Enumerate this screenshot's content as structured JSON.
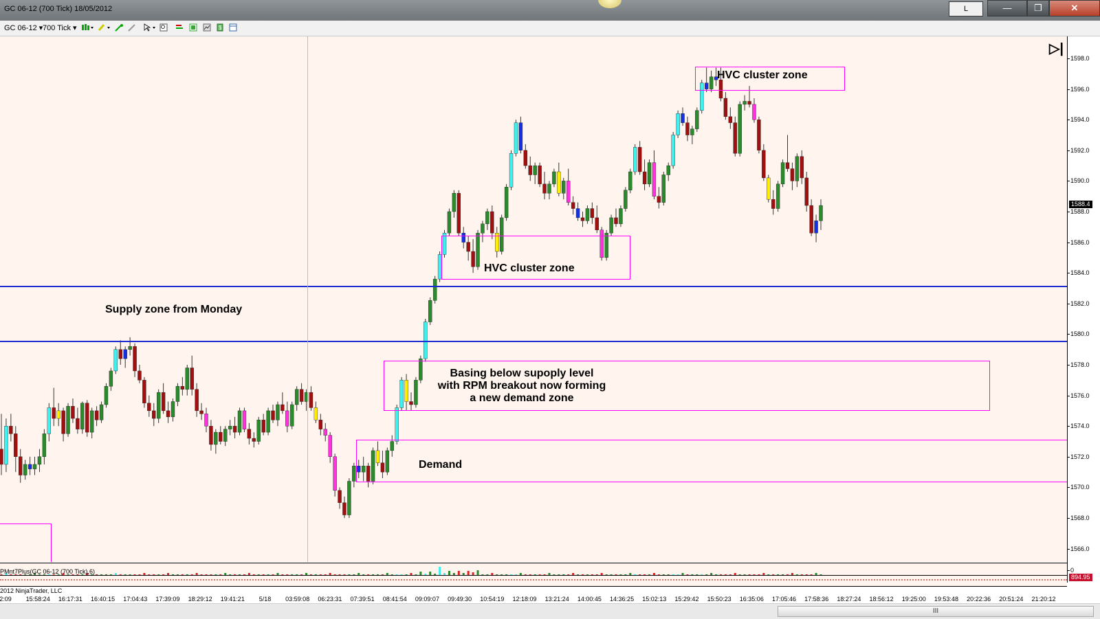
{
  "window": {
    "title": "GC 06-12 (700 Tick)  18/05/2012",
    "buttons": {
      "l": "L",
      "min": "—",
      "max": "❐",
      "close": "✕"
    }
  },
  "toolbar": {
    "instrument": "GC 06-12",
    "interval": "700 Tick",
    "dropdown_arrow": "▾"
  },
  "chart": {
    "annotations": {
      "supply": "Supply zone from Monday",
      "hvc_top": "HVC cluster zone",
      "hvc_mid": "HVC cluster zone",
      "basing_line1": "Basing below supoply level",
      "basing_line2": "with RPM breakout now forming",
      "basing_line3": "a new demand zone",
      "demand": "Demand"
    },
    "y_ticks": [
      "1598.0",
      "1596.0",
      "1594.0",
      "1592.0",
      "1590.0",
      "1588.0",
      "1586.0",
      "1584.0",
      "1582.0",
      "1580.0",
      "1578.0",
      "1576.0",
      "1574.0",
      "1572.0",
      "1570.0",
      "1568.0",
      "1566.0"
    ],
    "last_price": "1588.4",
    "indicator_value": "894.95",
    "indicator_zero": "0",
    "x_ticks": [
      "2:09",
      "15:58:24",
      "16:17:31",
      "16:40:15",
      "17:04:43",
      "17:39:09",
      "18:29:12",
      "19:41:21",
      "5/18",
      "03:59:08",
      "06:23:31",
      "07:39:51",
      "08:41:54",
      "09:09:07",
      "09:49:30",
      "10:54:19",
      "12:18:09",
      "13:21:24",
      "14:00:45",
      "14:36:25",
      "15:02:13",
      "15:29:42",
      "15:50:23",
      "16:35:06",
      "17:05:46",
      "17:58:36",
      "18:27:24",
      "18:56:12",
      "19:25:00",
      "19:53:48",
      "20:22:36",
      "20:51:24",
      "21:20:12"
    ],
    "indicator_label": "PMnt7Plus(GC 06-12 (700 Tick),6)",
    "copyright": "2012 NinjaTrader, LLC",
    "colors": {
      "bull": "#2b8a2b",
      "bear": "#a01010",
      "cyan": "#3ff0f0",
      "blue": "#1530e0",
      "yellow": "#ffee00",
      "magenta": "#ff33dd",
      "zone": "#ff00ff",
      "level": "#1a2bd6"
    },
    "scroll_grip": "III",
    "end_button": "▷|"
  },
  "chart_data": {
    "type": "candlestick",
    "symbol": "GC 06-12",
    "interval": "700 Tick",
    "ylim": [
      1565.5,
      1598.5
    ],
    "levels": [
      1583.0,
      1579.4
    ],
    "candles": [
      [
        1572.5,
        1574.8,
        1570.8,
        1571.5,
        "bear"
      ],
      [
        1571.5,
        1574.5,
        1571.0,
        1574.0,
        "cyan"
      ],
      [
        1574.0,
        1574.8,
        1573.0,
        1573.5,
        "bear"
      ],
      [
        1573.5,
        1574.0,
        1571.0,
        1572.0,
        "bear"
      ],
      [
        1572.0,
        1572.5,
        1570.3,
        1570.8,
        "bear"
      ],
      [
        1570.8,
        1571.8,
        1570.5,
        1571.5,
        "bull"
      ],
      [
        1571.5,
        1572.0,
        1570.8,
        1571.2,
        "blue"
      ],
      [
        1571.2,
        1572.0,
        1570.8,
        1571.5,
        "bull"
      ],
      [
        1571.5,
        1572.5,
        1571.0,
        1572.0,
        "bull"
      ],
      [
        1572.0,
        1573.8,
        1571.5,
        1573.5,
        "bull"
      ],
      [
        1573.5,
        1575.5,
        1573.0,
        1575.2,
        "cyan"
      ],
      [
        1575.2,
        1576.5,
        1574.0,
        1574.5,
        "bear"
      ],
      [
        1574.5,
        1575.5,
        1574.0,
        1575.0,
        "yellow"
      ],
      [
        1575.0,
        1575.2,
        1573.0,
        1573.5,
        "bear"
      ],
      [
        1573.5,
        1575.5,
        1573.3,
        1575.3,
        "bull"
      ],
      [
        1575.3,
        1575.8,
        1574.2,
        1574.5,
        "bear"
      ],
      [
        1574.5,
        1575.2,
        1573.5,
        1573.8,
        "bear"
      ],
      [
        1573.8,
        1575.6,
        1573.5,
        1575.5,
        "bull"
      ],
      [
        1575.5,
        1575.7,
        1573.3,
        1573.6,
        "bear"
      ],
      [
        1573.6,
        1575.2,
        1573.2,
        1575.0,
        "bull"
      ],
      [
        1575.0,
        1575.3,
        1574.0,
        1574.4,
        "bear"
      ],
      [
        1574.4,
        1575.6,
        1574.2,
        1575.4,
        "bull"
      ],
      [
        1575.4,
        1576.8,
        1575.2,
        1576.6,
        "bull"
      ],
      [
        1576.6,
        1577.8,
        1576.3,
        1577.6,
        "bull"
      ],
      [
        1577.6,
        1579.2,
        1577.4,
        1579.0,
        "cyan"
      ],
      [
        1579.0,
        1579.6,
        1578.0,
        1578.4,
        "bear"
      ],
      [
        1578.4,
        1579.2,
        1577.8,
        1579.0,
        "blue"
      ],
      [
        1579.0,
        1579.8,
        1578.6,
        1579.2,
        "bull"
      ],
      [
        1579.2,
        1579.4,
        1577.2,
        1577.6,
        "bear"
      ],
      [
        1577.6,
        1578.0,
        1576.8,
        1577.0,
        "bear"
      ],
      [
        1577.0,
        1577.2,
        1575.2,
        1575.5,
        "bear"
      ],
      [
        1575.5,
        1576.0,
        1574.6,
        1575.0,
        "bear"
      ],
      [
        1575.0,
        1575.5,
        1574.0,
        1574.5,
        "bear"
      ],
      [
        1574.5,
        1576.4,
        1574.2,
        1576.2,
        "bull"
      ],
      [
        1576.2,
        1576.8,
        1574.8,
        1575.0,
        "bear"
      ],
      [
        1575.0,
        1575.6,
        1574.2,
        1574.6,
        "bear"
      ],
      [
        1574.6,
        1575.8,
        1574.3,
        1575.6,
        "bull"
      ],
      [
        1575.6,
        1576.8,
        1575.3,
        1576.6,
        "bull"
      ],
      [
        1576.6,
        1577.2,
        1576.0,
        1576.4,
        "bear"
      ],
      [
        1576.4,
        1578.0,
        1576.0,
        1577.8,
        "bull"
      ],
      [
        1577.8,
        1578.6,
        1576.0,
        1576.4,
        "bear"
      ],
      [
        1576.4,
        1576.8,
        1574.6,
        1575.0,
        "bear"
      ],
      [
        1575.0,
        1575.5,
        1574.4,
        1574.8,
        "bear"
      ],
      [
        1574.8,
        1575.2,
        1573.6,
        1574.0,
        "magenta"
      ],
      [
        1574.0,
        1574.4,
        1572.4,
        1572.8,
        "bear"
      ],
      [
        1572.8,
        1573.8,
        1572.2,
        1573.6,
        "bull"
      ],
      [
        1573.6,
        1574.0,
        1572.8,
        1573.0,
        "bear"
      ],
      [
        1573.0,
        1574.0,
        1572.7,
        1573.8,
        "bull"
      ],
      [
        1573.8,
        1574.4,
        1573.4,
        1574.0,
        "bull"
      ],
      [
        1574.0,
        1574.6,
        1573.2,
        1573.6,
        "bear"
      ],
      [
        1573.6,
        1575.2,
        1573.4,
        1575.0,
        "bull"
      ],
      [
        1575.0,
        1575.2,
        1573.6,
        1573.8,
        "magenta"
      ],
      [
        1573.8,
        1574.2,
        1572.8,
        1573.2,
        "bear"
      ],
      [
        1573.2,
        1573.6,
        1572.6,
        1573.0,
        "bear"
      ],
      [
        1573.0,
        1574.6,
        1572.8,
        1574.4,
        "bull"
      ],
      [
        1574.4,
        1574.8,
        1573.4,
        1573.6,
        "bear"
      ],
      [
        1573.6,
        1575.2,
        1573.4,
        1575.0,
        "bull"
      ],
      [
        1575.0,
        1575.4,
        1574.2,
        1574.4,
        "bear"
      ],
      [
        1574.4,
        1575.6,
        1574.0,
        1575.4,
        "bull"
      ],
      [
        1575.4,
        1576.2,
        1574.8,
        1575.0,
        "bear"
      ],
      [
        1575.0,
        1575.6,
        1573.6,
        1574.0,
        "magenta"
      ],
      [
        1574.0,
        1575.6,
        1573.8,
        1575.4,
        "bull"
      ],
      [
        1575.4,
        1576.6,
        1575.0,
        1576.4,
        "bull"
      ],
      [
        1576.4,
        1576.8,
        1575.4,
        1575.6,
        "bear"
      ],
      [
        1575.6,
        1576.4,
        1575.0,
        1576.2,
        "bull"
      ],
      [
        1576.2,
        1576.6,
        1575.0,
        1575.2,
        "bear"
      ],
      [
        1575.2,
        1575.6,
        1574.2,
        1574.4,
        "yellow"
      ],
      [
        1574.4,
        1574.8,
        1573.4,
        1573.8,
        "bear"
      ],
      [
        1573.8,
        1574.2,
        1573.0,
        1573.4,
        "magenta"
      ],
      [
        1573.4,
        1573.6,
        1571.6,
        1572.0,
        "magenta"
      ],
      [
        1572.0,
        1572.2,
        1569.4,
        1569.8,
        "magenta"
      ],
      [
        1569.8,
        1570.0,
        1568.6,
        1569.0,
        "bear"
      ],
      [
        1569.0,
        1569.4,
        1568.0,
        1568.2,
        "bear"
      ],
      [
        1568.2,
        1570.6,
        1568.0,
        1570.4,
        "bull"
      ],
      [
        1570.4,
        1571.6,
        1570.0,
        1571.4,
        "bull"
      ],
      [
        1571.4,
        1571.8,
        1570.6,
        1571.0,
        "blue"
      ],
      [
        1571.0,
        1572.0,
        1570.4,
        1571.4,
        "bull"
      ],
      [
        1571.4,
        1571.6,
        1570.0,
        1570.4,
        "bear"
      ],
      [
        1570.4,
        1572.6,
        1570.2,
        1572.4,
        "bull"
      ],
      [
        1572.4,
        1573.0,
        1571.4,
        1571.6,
        "yellow"
      ],
      [
        1571.6,
        1572.4,
        1570.6,
        1571.0,
        "bear"
      ],
      [
        1571.0,
        1572.6,
        1570.8,
        1572.4,
        "bull"
      ],
      [
        1572.4,
        1573.4,
        1572.0,
        1573.0,
        "bull"
      ],
      [
        1573.0,
        1575.4,
        1572.8,
        1575.2,
        "cyan"
      ],
      [
        1575.2,
        1577.2,
        1575.0,
        1577.0,
        "cyan"
      ],
      [
        1577.0,
        1577.4,
        1575.0,
        1575.6,
        "yellow"
      ],
      [
        1575.6,
        1576.2,
        1575.0,
        1575.4,
        "bear"
      ],
      [
        1575.4,
        1577.2,
        1575.2,
        1577.0,
        "bull"
      ],
      [
        1577.0,
        1578.6,
        1576.8,
        1578.4,
        "bull"
      ],
      [
        1578.4,
        1581.0,
        1578.2,
        1580.8,
        "cyan"
      ],
      [
        1580.8,
        1582.4,
        1580.6,
        1582.2,
        "bull"
      ],
      [
        1582.2,
        1583.8,
        1582.0,
        1583.6,
        "bull"
      ],
      [
        1583.6,
        1585.4,
        1583.4,
        1585.2,
        "cyan"
      ],
      [
        1585.2,
        1586.8,
        1585.0,
        1586.6,
        "cyan"
      ],
      [
        1586.6,
        1588.2,
        1586.4,
        1588.0,
        "bull"
      ],
      [
        1588.0,
        1589.4,
        1587.6,
        1589.2,
        "bull"
      ],
      [
        1589.2,
        1589.4,
        1586.4,
        1586.6,
        "bear"
      ],
      [
        1586.6,
        1587.0,
        1585.6,
        1586.0,
        "blue"
      ],
      [
        1586.0,
        1586.4,
        1584.8,
        1585.4,
        "bear"
      ],
      [
        1585.4,
        1586.2,
        1584.0,
        1584.4,
        "bear"
      ],
      [
        1584.4,
        1586.8,
        1584.2,
        1586.6,
        "bull"
      ],
      [
        1586.6,
        1587.4,
        1586.0,
        1587.2,
        "bull"
      ],
      [
        1587.2,
        1588.2,
        1586.8,
        1588.0,
        "bull"
      ],
      [
        1588.0,
        1588.4,
        1586.2,
        1586.6,
        "bear"
      ],
      [
        1586.6,
        1587.0,
        1585.0,
        1585.4,
        "yellow"
      ],
      [
        1585.4,
        1587.8,
        1585.2,
        1587.6,
        "bull"
      ],
      [
        1587.6,
        1589.8,
        1587.4,
        1589.6,
        "bull"
      ],
      [
        1589.6,
        1592.0,
        1589.4,
        1591.8,
        "cyan"
      ],
      [
        1591.8,
        1594.0,
        1591.6,
        1593.8,
        "cyan"
      ],
      [
        1593.8,
        1594.2,
        1591.8,
        1592.0,
        "blue"
      ],
      [
        1592.0,
        1592.4,
        1590.8,
        1591.0,
        "bear"
      ],
      [
        1591.0,
        1591.6,
        1590.0,
        1590.4,
        "bear"
      ],
      [
        1590.4,
        1591.2,
        1589.8,
        1591.0,
        "bull"
      ],
      [
        1591.0,
        1591.2,
        1589.6,
        1589.8,
        "bear"
      ],
      [
        1589.8,
        1590.6,
        1588.8,
        1589.2,
        "bear"
      ],
      [
        1589.2,
        1590.0,
        1588.8,
        1589.8,
        "bull"
      ],
      [
        1589.8,
        1590.8,
        1589.6,
        1590.6,
        "bull"
      ],
      [
        1590.6,
        1591.2,
        1589.0,
        1589.2,
        "yellow"
      ],
      [
        1589.2,
        1590.2,
        1588.8,
        1590.0,
        "bull"
      ],
      [
        1590.0,
        1590.8,
        1588.4,
        1588.6,
        "magenta"
      ],
      [
        1588.6,
        1589.0,
        1587.8,
        1588.2,
        "bear"
      ],
      [
        1588.2,
        1588.6,
        1587.4,
        1587.6,
        "blue"
      ],
      [
        1587.6,
        1588.0,
        1587.0,
        1587.4,
        "bear"
      ],
      [
        1587.4,
        1588.4,
        1587.2,
        1588.2,
        "bull"
      ],
      [
        1588.2,
        1588.6,
        1587.2,
        1587.6,
        "bear"
      ],
      [
        1587.6,
        1588.4,
        1586.6,
        1586.8,
        "bear"
      ],
      [
        1586.8,
        1587.0,
        1584.8,
        1585.0,
        "magenta"
      ],
      [
        1585.0,
        1586.8,
        1584.8,
        1586.6,
        "bull"
      ],
      [
        1586.6,
        1587.8,
        1586.4,
        1587.6,
        "bull"
      ],
      [
        1587.6,
        1588.2,
        1587.0,
        1587.2,
        "bear"
      ],
      [
        1587.2,
        1588.4,
        1587.0,
        1588.2,
        "bull"
      ],
      [
        1588.2,
        1589.6,
        1588.0,
        1589.4,
        "bull"
      ],
      [
        1589.4,
        1590.8,
        1589.2,
        1590.6,
        "bull"
      ],
      [
        1590.6,
        1592.4,
        1590.4,
        1592.2,
        "cyan"
      ],
      [
        1592.2,
        1592.6,
        1590.4,
        1590.6,
        "bear"
      ],
      [
        1590.6,
        1591.4,
        1589.4,
        1589.8,
        "bear"
      ],
      [
        1589.8,
        1591.4,
        1589.6,
        1591.2,
        "bull"
      ],
      [
        1591.2,
        1592.0,
        1588.8,
        1589.0,
        "magenta"
      ],
      [
        1589.0,
        1589.6,
        1588.2,
        1588.6,
        "bear"
      ],
      [
        1588.6,
        1590.6,
        1588.4,
        1590.4,
        "bull"
      ],
      [
        1590.4,
        1591.2,
        1590.0,
        1591.0,
        "bull"
      ],
      [
        1591.0,
        1593.2,
        1590.8,
        1593.0,
        "cyan"
      ],
      [
        1593.0,
        1594.6,
        1592.8,
        1594.4,
        "cyan"
      ],
      [
        1594.4,
        1594.8,
        1593.6,
        1593.8,
        "blue"
      ],
      [
        1593.8,
        1594.2,
        1592.6,
        1593.0,
        "bear"
      ],
      [
        1593.0,
        1593.6,
        1592.4,
        1593.4,
        "bull"
      ],
      [
        1593.4,
        1594.8,
        1593.2,
        1594.6,
        "bull"
      ],
      [
        1594.6,
        1596.6,
        1594.4,
        1596.4,
        "cyan"
      ],
      [
        1596.4,
        1597.4,
        1595.8,
        1596.0,
        "blue"
      ],
      [
        1596.0,
        1597.2,
        1595.8,
        1596.8,
        "bull"
      ],
      [
        1596.8,
        1597.4,
        1596.2,
        1596.6,
        "blue"
      ],
      [
        1596.6,
        1597.4,
        1595.2,
        1595.4,
        "bear"
      ],
      [
        1595.4,
        1595.8,
        1594.0,
        1594.2,
        "bear"
      ],
      [
        1594.2,
        1594.8,
        1593.4,
        1593.8,
        "bear"
      ],
      [
        1593.8,
        1594.2,
        1591.6,
        1591.8,
        "bear"
      ],
      [
        1591.8,
        1595.2,
        1591.6,
        1595.0,
        "bull"
      ],
      [
        1595.0,
        1595.6,
        1594.6,
        1595.2,
        "bull"
      ],
      [
        1595.2,
        1596.2,
        1594.8,
        1595.0,
        "bear"
      ],
      [
        1595.0,
        1595.4,
        1593.8,
        1594.0,
        "magenta"
      ],
      [
        1594.0,
        1594.2,
        1591.8,
        1592.0,
        "bear"
      ],
      [
        1592.0,
        1592.4,
        1590.0,
        1590.2,
        "bear"
      ],
      [
        1590.2,
        1590.4,
        1588.6,
        1588.8,
        "yellow"
      ],
      [
        1588.8,
        1589.4,
        1587.8,
        1588.2,
        "bear"
      ],
      [
        1588.2,
        1590.0,
        1588.0,
        1589.8,
        "bull"
      ],
      [
        1589.8,
        1591.4,
        1589.6,
        1591.2,
        "bull"
      ],
      [
        1591.2,
        1593.0,
        1590.6,
        1590.8,
        "bear"
      ],
      [
        1590.8,
        1591.2,
        1589.4,
        1590.0,
        "bear"
      ],
      [
        1590.0,
        1591.8,
        1589.6,
        1591.6,
        "bull"
      ],
      [
        1591.6,
        1592.0,
        1589.8,
        1590.2,
        "bear"
      ],
      [
        1590.2,
        1590.6,
        1588.0,
        1588.4,
        "bear"
      ],
      [
        1588.4,
        1588.8,
        1586.4,
        1586.6,
        "bear"
      ],
      [
        1586.6,
        1587.8,
        1586.0,
        1587.4,
        "blue"
      ],
      [
        1587.4,
        1588.8,
        1586.8,
        1588.4,
        "bull"
      ]
    ],
    "demand_box_left": [
      [
        1572.4,
        1573.2,
        0.22,
        0.2
      ],
      [
        1571.0,
        1571.4,
        0.05,
        0.05
      ]
    ]
  }
}
